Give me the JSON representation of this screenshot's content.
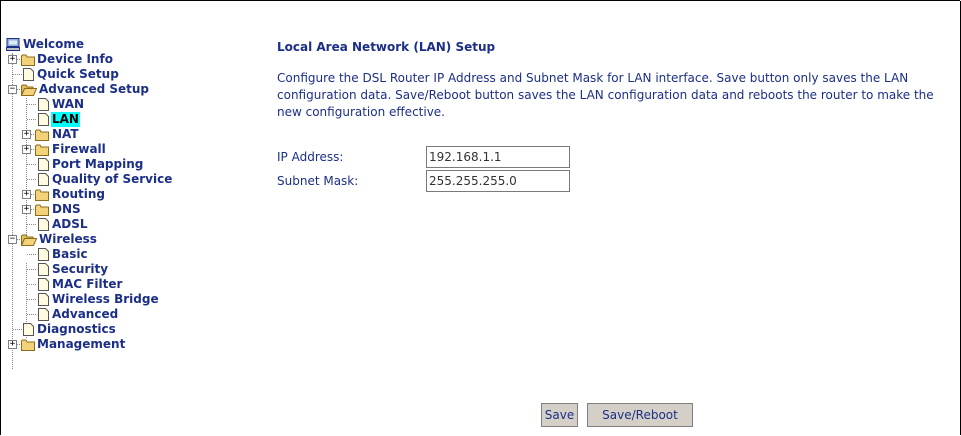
{
  "nav": {
    "welcome": "Welcome",
    "device_info": "Device Info",
    "quick_setup": "Quick Setup",
    "advanced_setup": "Advanced Setup",
    "wan": "WAN",
    "lan": "LAN",
    "nat": "NAT",
    "firewall": "Firewall",
    "port_mapping": "Port Mapping",
    "qos": "Quality of Service",
    "routing": "Routing",
    "dns": "DNS",
    "adsl": "ADSL",
    "wireless": "Wireless",
    "basic": "Basic",
    "security": "Security",
    "mac_filter": "MAC Filter",
    "wireless_bridge": "Wireless Bridge",
    "advanced": "Advanced",
    "diagnostics": "Diagnostics",
    "management": "Management",
    "selected": "LAN"
  },
  "page": {
    "title": "Local Area Network (LAN) Setup",
    "description": "Configure the DSL Router IP Address and Subnet Mask for LAN interface.  Save button only saves the LAN configuration data. Save/Reboot button saves the LAN configuration data and reboots the router to make the new configuration effective."
  },
  "form": {
    "ip_label": "IP Address:",
    "ip_value": "192.168.1.1",
    "mask_label": "Subnet Mask:",
    "mask_value": "255.255.255.0"
  },
  "buttons": {
    "save": "Save",
    "save_reboot": "Save/Reboot"
  },
  "colors": {
    "text": "#1c2f86",
    "selected_bg": "#00ffff",
    "folder": "#f3d27a"
  }
}
